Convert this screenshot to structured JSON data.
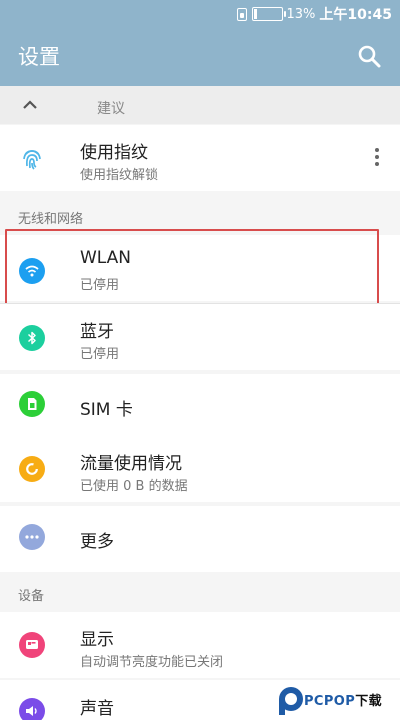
{
  "status_bar": {
    "battery": "13%",
    "battery_level": 0.13,
    "time_prefix": "上午",
    "time": "10:45"
  },
  "app_bar": {
    "title": "设置",
    "search_icon": "search-icon"
  },
  "suggestions": {
    "collapse_icon": "chevron-up-icon",
    "label": "建议",
    "item": {
      "title": "使用指纹",
      "subtitle": "使用指纹解锁",
      "icon": "fingerprint-icon"
    }
  },
  "sections": {
    "wireless": "无线和网络",
    "device": "设备"
  },
  "items": {
    "wlan": {
      "title": "WLAN",
      "subtitle": "已停用",
      "icon": "wifi-icon",
      "color": "#1c9ff0"
    },
    "bluetooth": {
      "title": "蓝牙",
      "subtitle": "已停用",
      "icon": "bluetooth-icon",
      "color": "#1ccf9e"
    },
    "sim": {
      "title": "SIM 卡",
      "icon": "sim-card-icon",
      "color": "#2ccf38"
    },
    "data_usage": {
      "title": "流量使用情况",
      "subtitle": "已使用 0 B 的数据",
      "icon": "data-usage-icon",
      "color": "#f7ac14"
    },
    "more": {
      "title": "更多",
      "icon": "more-horizontal-icon",
      "color": "#93a8dc"
    },
    "display": {
      "title": "显示",
      "subtitle": "自动调节亮度功能已关闭",
      "icon": "display-icon",
      "color": "#f0447a"
    },
    "sound": {
      "title": "声音",
      "icon": "volume-icon",
      "color": "#7b4ce8"
    }
  },
  "watermark": {
    "brand": "PCPOP",
    "suffix": "下载"
  },
  "colors": {
    "app_bar": "#8fb4cb",
    "highlight": "#d84c4c",
    "fingerprint": "#4fb6e8"
  }
}
